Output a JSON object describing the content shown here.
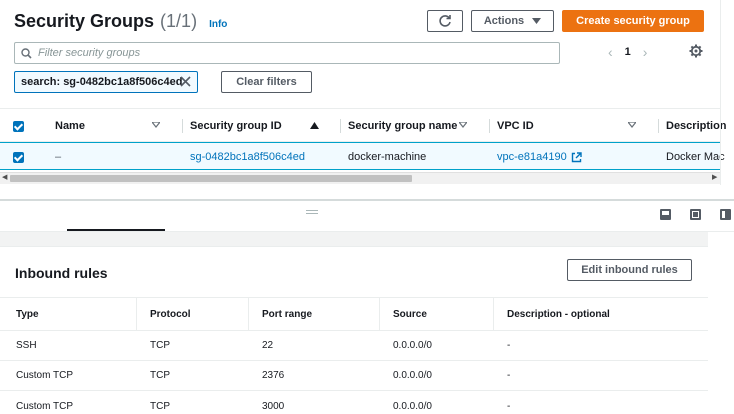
{
  "header": {
    "title": "Security Groups",
    "count": "(1/1)",
    "info": "Info",
    "actions_label": "Actions",
    "create_label": "Create security group"
  },
  "search": {
    "placeholder": "Filter security groups",
    "value": "",
    "token": "search: sg-0482bc1a8f506c4ed",
    "clear_label": "Clear filters"
  },
  "pagination": {
    "page": "1"
  },
  "table": {
    "columns": [
      "Name",
      "Security group ID",
      "Security group name",
      "VPC ID",
      "Description"
    ],
    "rows": [
      {
        "name": "–",
        "group_id": "sg-0482bc1a8f506c4ed",
        "group_name": "docker-machine",
        "vpc_id": "vpc-e81a4190",
        "description": "Docker Mac"
      }
    ]
  },
  "inbound": {
    "title": "Inbound rules",
    "edit_label": "Edit inbound rules",
    "columns": [
      "Type",
      "Protocol",
      "Port range",
      "Source",
      "Description - optional"
    ],
    "rows": [
      {
        "type": "SSH",
        "protocol": "TCP",
        "port": "22",
        "source": "0.0.0.0/0",
        "desc": "-"
      },
      {
        "type": "Custom TCP",
        "protocol": "TCP",
        "port": "2376",
        "source": "0.0.0.0/0",
        "desc": "-"
      },
      {
        "type": "Custom TCP",
        "protocol": "TCP",
        "port": "3000",
        "source": "0.0.0.0/0",
        "desc": "-"
      }
    ]
  },
  "colors": {
    "accent": "#0073bb",
    "primary": "#ec7211",
    "selected_bg": "#f1faff"
  }
}
